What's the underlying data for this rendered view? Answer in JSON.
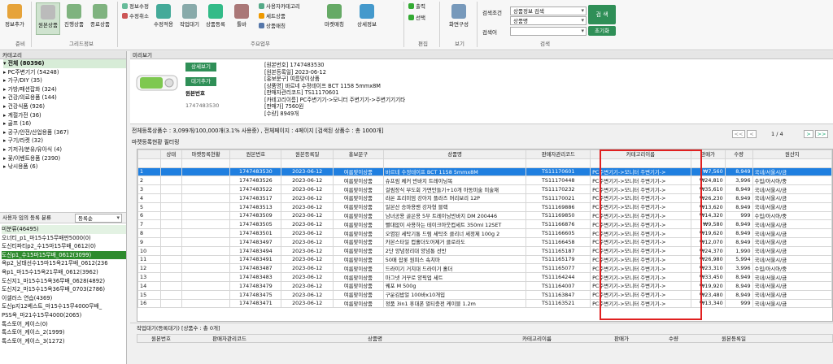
{
  "ribbon": {
    "buttons": [
      {
        "label": "정보추가",
        "icon": "info-add-icon"
      },
      {
        "label": "원본상품",
        "icon": "original-goods-icon",
        "active": true
      },
      {
        "label": "진행상품",
        "icon": "progress-goods-icon"
      },
      {
        "label": "종료상품",
        "icon": "end-goods-icon"
      },
      {
        "label": "수정적용",
        "icon": "apply-edit-icon"
      },
      {
        "label": "작업대기",
        "icon": "wait-job-icon"
      },
      {
        "label": "상품등록",
        "icon": "register-icon"
      },
      {
        "label": "툴바",
        "icon": "toolbar-icon"
      },
      {
        "label": "마켓매칭",
        "icon": "market-match-icon"
      },
      {
        "label": "상세정보",
        "icon": "detail-info-icon"
      },
      {
        "label": "화면구성",
        "icon": "layout-icon"
      }
    ],
    "small": {
      "info_edit": "정보수정",
      "edit_cancel": "수정취소",
      "user_category": "사용자카테고리",
      "set_goods": "세트상품",
      "goods_matching": "상품매칭",
      "output": "출력",
      "select": "선택"
    },
    "groups": {
      "prepare": "준비",
      "grid_info": "그리드정보",
      "main_func": "주요업무",
      "edit": "편집",
      "view": "보기",
      "search": "검색"
    },
    "search": {
      "cond_label": "검색조건",
      "word_label": "검색어",
      "cond1": "상품정보 검색",
      "cond2": "상품명",
      "search_btn": "검 색",
      "reset_btn": "초기화"
    }
  },
  "left": {
    "category_header": "카테고리",
    "tree": [
      "전체 (80396)",
      "PC주변기기 (54248)",
      "가구/DIY (35)",
      "가방/패션잡화 (324)",
      "건강/의료용품 (144)",
      "건강식품 (926)",
      "계절가전 (36)",
      "골프 (16)",
      "공구/안전/산업용품 (367)",
      "구기/라켓 (32)",
      "기저귀/분유/유아식 (4)",
      "꽃/이벤트용품 (2390)",
      "낚시용품 (6)"
    ],
    "user_sort_label": "사용자 임의 등록 분류",
    "user_sort_value": "등록순",
    "categories": [
      "미분류(46495)",
      "오너티_p1_마15수15무배판5000(0)",
      "도신티파티p2_수15마15무배_0612(0)",
      "도신p1_수15마15무배_0612(3099)",
      "옥p2_남태선수15마15옥21무배_0612(236",
      "옥p1_마15수15옥21무배_0612(3962)",
      "도신지1_마15수15옥36무배_0628(4892)",
      "도신지2_마15수15옥36무배_0703(2786)",
      "이셀러스 연습(4369)",
      "도신p지12베스트_마15수15무4000무배_",
      "PSS옥_마21수15무4000(2065)",
      "톡스토어_케이스(0)",
      "톡스토어_케이스_2(1999)",
      "톡스토어_케이스_3(1272)"
    ]
  },
  "preview": {
    "title": "미리보기",
    "detail_btn": "상세보기",
    "wait_btn": "대기추가",
    "orig_label": "원본번호",
    "orig_num": "1747483530",
    "info": [
      "[원본번호] 1747483530",
      "[원본등록일] 2023-06-12",
      "[홍보문구] 여름맞이상품",
      "[상품명] 바르네 수정테이프 BCT 1158 5mmx8M",
      "[판매자관리코드] TS11170601",
      "[카테고리이름] PC주변기기->모니터 주변기기->주변기기기타",
      "[판매가] 7560원",
      "[수량] 8949개"
    ]
  },
  "status": {
    "summary": "전체등록상품수 : 3,099개/100,000개(3.1% 사용중) , 전체페이지 : 4페이지 [검색된 상품수 : 총 1000개]",
    "market_label": "마켓등록현황 필터링",
    "page": "1 / 4",
    "first": "<<",
    "prev": "<",
    "next": ">",
    "last": ">>"
  },
  "grid": {
    "headers": [
      "",
      "상태",
      "마켓등록현황",
      "원본번호",
      "원본등록일",
      "홍보문구",
      "상품명",
      "판매자관리코드",
      "카테고리이름",
      "판매가",
      "수량",
      "원산지"
    ],
    "rows": [
      [
        "1",
        "1747483530",
        "2023-06-12",
        "여름맞이상품",
        "바르네 수정테이프 BCT 1158 5mmx8M",
        "TS11170601",
        "PC주변기기->모니터 주변기기->",
        "₩7,560",
        "8,949",
        "국내/서울시/금"
      ],
      [
        "2",
        "1747483526",
        "2023-06-12",
        "여름맞이상품",
        "슈프림 체커 반바지 트레이닝복",
        "TS11170448",
        "PC주변기기->모니터 주변기기->",
        "₩24,810",
        "3,996",
        "수입/아시아/중"
      ],
      [
        "3",
        "1747483522",
        "2023-06-12",
        "여름맞이상품",
        "걸림장식 무도회 가면만들기+10개 아동미술 미술재",
        "TS11170232",
        "PC주변기기->모니터 주변기기->",
        "₩35,610",
        "8,949",
        "국내/서울시/금"
      ],
      [
        "4",
        "1747483517",
        "2023-06-12",
        "여름맞이상품",
        "라온 프리미엄 강아지 플라즈 머리보리 12P",
        "TS11170021",
        "PC주변기기->모니터 주변기기->",
        "₩26,230",
        "8,949",
        "국내/서울시/금"
      ],
      [
        "5",
        "1747483513",
        "2023-06-12",
        "여름맞이상품",
        "일본산 승마용밴 강자형 블랙",
        "TS11169886",
        "PC주변기기->모니터 주변기기->",
        "₩13,620",
        "8,949",
        "국내/서울시/금"
      ],
      [
        "6",
        "1747483509",
        "2023-06-12",
        "여름맞이상품",
        "남녀공용 골은용 5부 트레이닝반바지 DM 200446",
        "TS11169850",
        "PC주변기기->모니터 주변기기->",
        "₩14,320",
        "999",
        "수입/아시아/중"
      ],
      [
        "7",
        "1747483505",
        "2023-06-12",
        "여름맞이상품",
        "빨대없이 사용하는 테이크아웃컵세트 350ml 12SET",
        "TS11166876",
        "PC주변기기->모니터 주변기기->",
        "₩9,580",
        "8,949",
        "국내/서울시/금"
      ],
      [
        "8",
        "1747483501",
        "2023-06-12",
        "여름맞이상품",
        "오염된 세탁기통 드럼 세탁조 클리너 세정제 100g 2",
        "TS11166605",
        "PC주변기기->모니터 주변기기->",
        "₩19,620",
        "8,949",
        "국내/서울시/금"
      ],
      [
        "9",
        "1747483497",
        "2023-06-12",
        "여름맞이상품",
        "카본스타일 컵홀더도어제거 클로라도",
        "TS11166458",
        "PC주변기기->모니터 주변기기->",
        "₩12,070",
        "8,949",
        "국내/서울시/금"
      ],
      [
        "10",
        "1747483494",
        "2023-06-12",
        "여름맞이상품",
        "2단 양념정리대 양념통 선반",
        "TS11165187",
        "PC주변기기->모니터 주변기기->",
        "₩24,370",
        "1,990",
        "국내/서울시/금"
      ],
      [
        "11",
        "1747483491",
        "2023-06-12",
        "여름맞이상품",
        "50매 잡롯 원피스 속치마",
        "TS11165179",
        "PC주변기기->모니터 주변기기->",
        "₩26,980",
        "5,994",
        "국내/서울시/금"
      ],
      [
        "12",
        "1747483487",
        "2023-06-12",
        "여름맞이상품",
        "드라이기 거치대 드라이기 홀더",
        "TS11165077",
        "PC주변기기->모니터 주변기기->",
        "₩23,310",
        "3,996",
        "수입/아시아/중"
      ],
      [
        "13",
        "1747483483",
        "2023-06-12",
        "여름맞이상품",
        "마그넷 거꾸로 양픽업 세트",
        "TS11164244",
        "PC주변기기->모니터 주변기기->",
        "₩33,450",
        "8,949",
        "국내/서울시/금"
      ],
      [
        "14",
        "1747483479",
        "2023-06-12",
        "여름맞이상품",
        "꿰포 M 500g",
        "TS11164007",
        "PC주변기기->모니터 주변기기->",
        "₩19,920",
        "8,949",
        "국내/서울시/금"
      ],
      [
        "15",
        "1747483475",
        "2023-06-12",
        "여름맞이상품",
        "구운김밥얼 100바x10개입",
        "TS11163847",
        "PC주변기기->모니터 주변기기->",
        "₩23,480",
        "8,949",
        "국내/서울시/금"
      ],
      [
        "16",
        "1747483471",
        "2023-06-12",
        "여름맞이상품",
        "정품 3in1 휴대폰 멀티충전 케이블 1.2m",
        "TS11163521",
        "PC주변기기->모니터 주변기기->",
        "₩13,340",
        "999",
        "국내/서울시/금"
      ]
    ]
  },
  "bottom": {
    "title": "작업대기(등록대기) [상품수 : 총 0개]",
    "headers": [
      "원본번호",
      "판매자관리코드",
      "상품명",
      "카테고리이름",
      "판매가",
      "수량",
      "원본등록일"
    ]
  },
  "colors": {
    "accent": "#2f8f57",
    "selected_row": "#1f7fe0",
    "highlight_box": "#e02020"
  }
}
